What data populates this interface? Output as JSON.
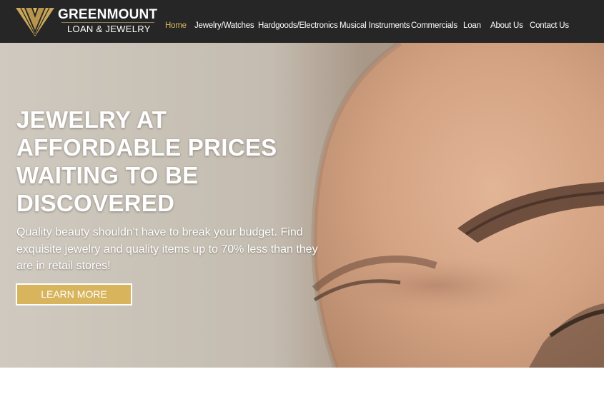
{
  "brand": {
    "name": "GREENMOUNT",
    "tagline": "LOAN & JEWELRY",
    "logo_icon": "chevron-diamond-logo-icon",
    "accent_color": "#d9b65b"
  },
  "nav": {
    "items": [
      {
        "label": "Home",
        "active": true
      },
      {
        "label": "Jewelry/Watches",
        "active": false
      },
      {
        "label": "Hardgoods/Electronics",
        "active": false
      },
      {
        "label": "Musical Instruments",
        "active": false
      },
      {
        "label": "Commercials",
        "active": false
      },
      {
        "label": "Loan",
        "active": false
      },
      {
        "label": "About Us",
        "active": false
      },
      {
        "label": "Contact Us",
        "active": false
      }
    ]
  },
  "hero": {
    "title": "JEWELRY AT AFFORDABLE PRICES WAITING TO BE DISCOVERED",
    "text": "Quality beauty shouldn't have to break your budget. Find exquisite jewelry and quality items up to 70% less than they are in retail stores!",
    "cta_label": "LEARN MORE",
    "cta_color": "#d8b45c"
  }
}
